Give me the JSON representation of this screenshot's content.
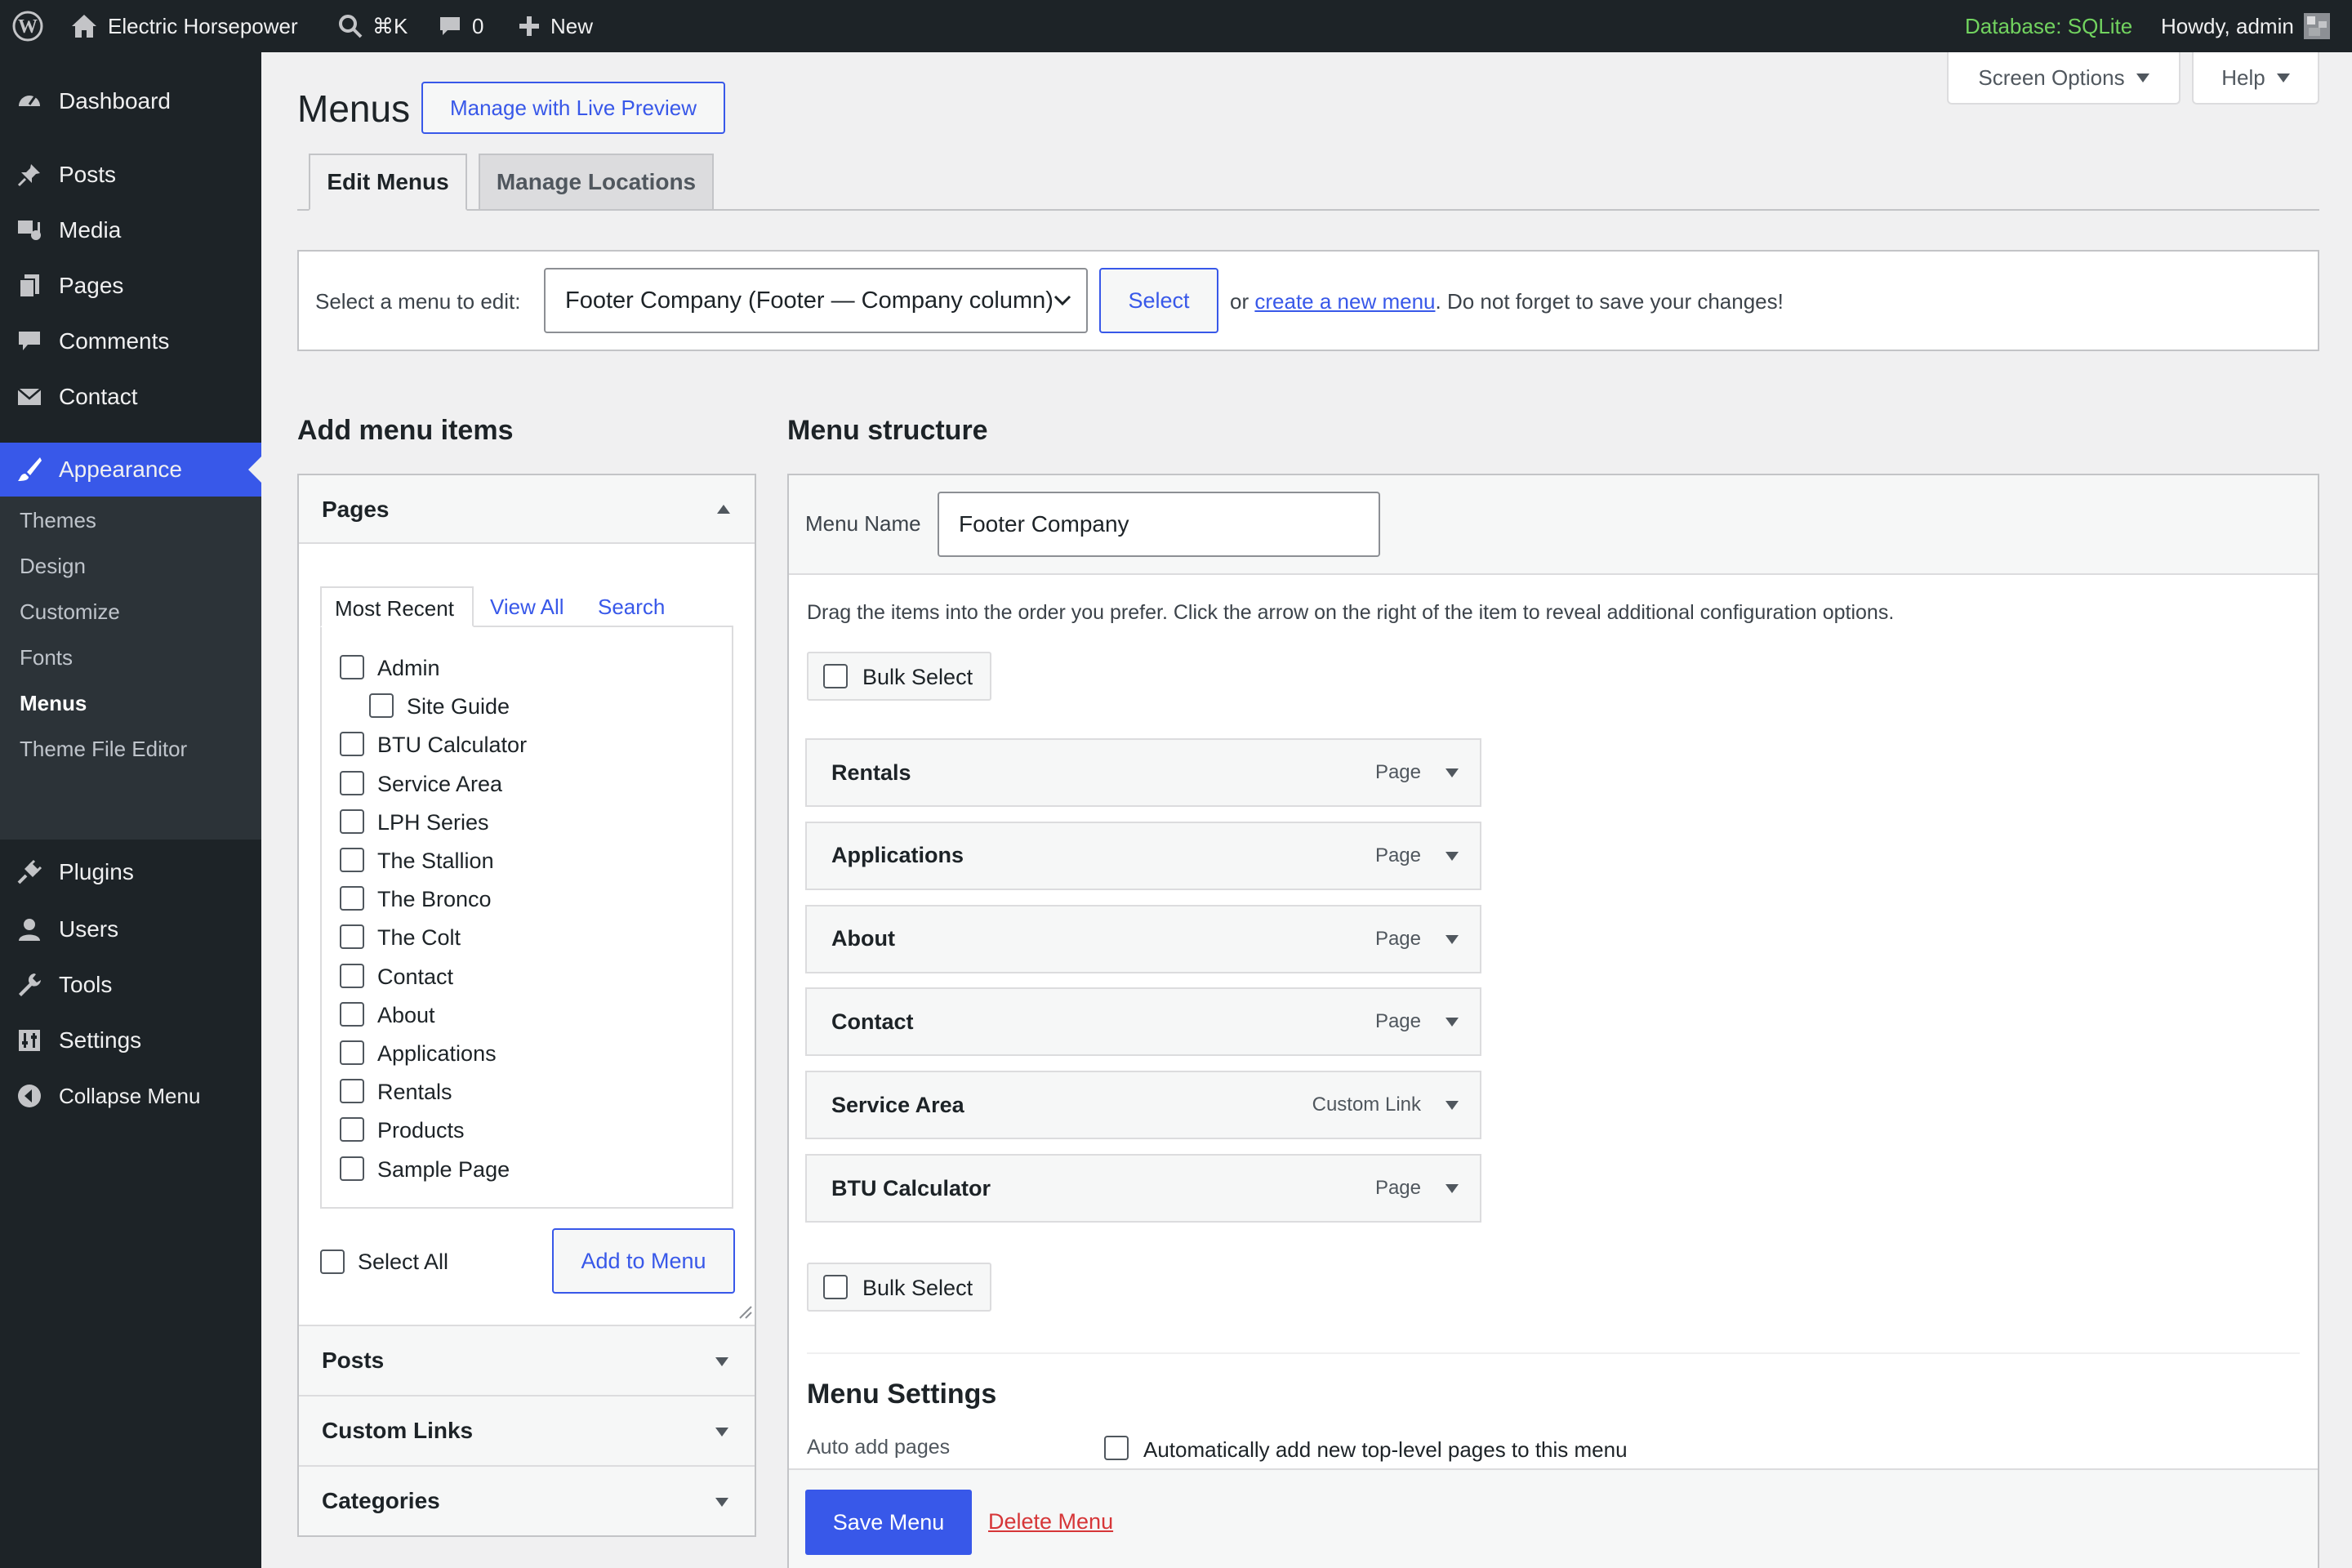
{
  "adminbar": {
    "site_name": "Electric Horsepower",
    "search_shortcut": "⌘K",
    "comments_count": "0",
    "new_label": "New",
    "database_status": "Database: SQLite",
    "howdy": "Howdy, admin",
    "icons": [
      "wordpress-logo-icon",
      "home-icon",
      "search-icon",
      "comment-bubble-icon",
      "plus-icon",
      "avatar"
    ]
  },
  "sidebar": {
    "items": [
      {
        "label": "Dashboard",
        "icon": "dashboard-icon"
      },
      {
        "label": "Posts",
        "icon": "pushpin-icon"
      },
      {
        "label": "Media",
        "icon": "media-icon"
      },
      {
        "label": "Pages",
        "icon": "pages-icon"
      },
      {
        "label": "Comments",
        "icon": "comment-icon"
      },
      {
        "label": "Contact",
        "icon": "envelope-icon"
      },
      {
        "label": "Appearance",
        "icon": "paintbrush-icon",
        "active": true
      },
      {
        "label": "Plugins",
        "icon": "plug-icon"
      },
      {
        "label": "Users",
        "icon": "user-icon"
      },
      {
        "label": "Tools",
        "icon": "wrench-icon"
      },
      {
        "label": "Settings",
        "icon": "settings-icon"
      },
      {
        "label": "Collapse Menu",
        "icon": "collapse-arrow-icon"
      }
    ],
    "submenu": [
      "Themes",
      "Design",
      "Customize",
      "Fonts",
      "Menus",
      "Theme File Editor"
    ],
    "current_submenu": "Menus",
    "accent_color": "#3858e9"
  },
  "header": {
    "title": "Menus",
    "live_preview_button": "Manage with Live Preview",
    "screen_options": "Screen Options",
    "help": "Help"
  },
  "tabs": [
    "Edit Menus",
    "Manage Locations"
  ],
  "select_bar": {
    "label": "Select a menu to edit:",
    "selected": "Footer Company (Footer — Company column)",
    "select_button": "Select",
    "or_text": "or",
    "create_link": "create a new menu",
    "after_text": ". Do not forget to save your changes!"
  },
  "add_items": {
    "heading": "Add menu items",
    "pages_section": "Pages",
    "subtabs": [
      "Most Recent",
      "View All",
      "Search"
    ],
    "pages": [
      {
        "label": "Admin",
        "child": false
      },
      {
        "label": "Site Guide",
        "child": true
      },
      {
        "label": "BTU Calculator",
        "child": false
      },
      {
        "label": "Service Area",
        "child": false
      },
      {
        "label": "LPH Series",
        "child": false
      },
      {
        "label": "The Stallion",
        "child": false
      },
      {
        "label": "The Bronco",
        "child": false
      },
      {
        "label": "The Colt",
        "child": false
      },
      {
        "label": "Contact",
        "child": false
      },
      {
        "label": "About",
        "child": false
      },
      {
        "label": "Applications",
        "child": false
      },
      {
        "label": "Rentals",
        "child": false
      },
      {
        "label": "Products",
        "child": false
      },
      {
        "label": "Sample Page",
        "child": false
      }
    ],
    "select_all": "Select All",
    "add_button": "Add to Menu",
    "collapsed_sections": [
      "Posts",
      "Custom Links",
      "Categories"
    ]
  },
  "structure": {
    "heading": "Menu structure",
    "menu_name_label": "Menu Name",
    "menu_name_value": "Footer Company",
    "instructions": "Drag the items into the order you prefer. Click the arrow on the right of the item to reveal additional configuration options.",
    "bulk_select": "Bulk Select",
    "items": [
      {
        "title": "Rentals",
        "type": "Page"
      },
      {
        "title": "Applications",
        "type": "Page"
      },
      {
        "title": "About",
        "type": "Page"
      },
      {
        "title": "Contact",
        "type": "Page"
      },
      {
        "title": "Service Area",
        "type": "Custom Link"
      },
      {
        "title": "BTU Calculator",
        "type": "Page"
      }
    ],
    "settings_heading": "Menu Settings",
    "auto_add_label": "Auto add pages",
    "auto_add_text": "Automatically add new top-level pages to this menu",
    "save_button": "Save Menu",
    "delete_link": "Delete Menu",
    "delete_color": "#d63638"
  }
}
